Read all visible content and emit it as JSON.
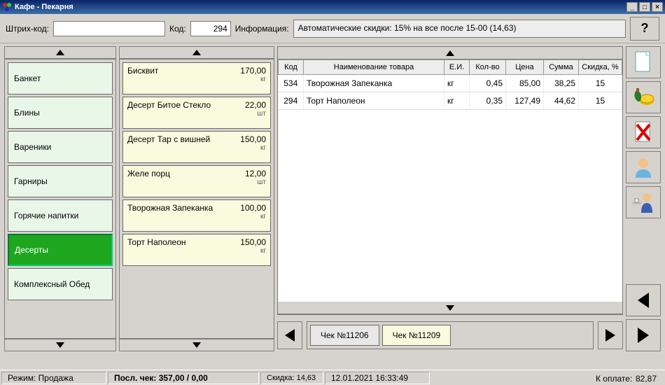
{
  "window": {
    "title": "Кафе - Пекарня"
  },
  "toprow": {
    "barcode_label": "Штрих-код:",
    "barcode_value": "",
    "code_label": "Код:",
    "code_value": "294",
    "info_label": "Информация:",
    "info_text": "Автоматические скидки: 15% на все после 15-00 (14,63)",
    "help_label": "?"
  },
  "categories": [
    {
      "label": "Банкет",
      "active": false
    },
    {
      "label": "Блины",
      "active": false
    },
    {
      "label": "Вареники",
      "active": false
    },
    {
      "label": "Гарниры",
      "active": false
    },
    {
      "label": "Горячие напитки",
      "active": false
    },
    {
      "label": "Десерты",
      "active": true
    },
    {
      "label": "Комплексный Обед",
      "active": false
    }
  ],
  "products": [
    {
      "name": "Бисквит",
      "price": "170,00",
      "unit": "кг"
    },
    {
      "name": "Десерт Битое Стекло",
      "price": "22,00",
      "unit": "шт"
    },
    {
      "name": "Десерт Тар с вишней",
      "price": "150,00",
      "unit": "кг"
    },
    {
      "name": "Желе порц",
      "price": "12,00",
      "unit": "шт"
    },
    {
      "name": "Творожная Запеканка",
      "price": "100,00",
      "unit": "кг"
    },
    {
      "name": "Торт Наполеон",
      "price": "150,00",
      "unit": "кг"
    }
  ],
  "grid": {
    "headers": {
      "code": "Код",
      "name": "Наименование товара",
      "unit": "Е.И.",
      "qty": "Кол-во",
      "price": "Цена",
      "sum": "Сумма",
      "disc": "Скидка, %"
    },
    "rows": [
      {
        "code": "534",
        "name": "Творожная Запеканка",
        "unit": "кг",
        "qty": "0,45",
        "price": "85,00",
        "sum": "38,25",
        "disc": "15"
      },
      {
        "code": "294",
        "name": "Торт Наполеон",
        "unit": "кг",
        "qty": "0,35",
        "price": "127,49",
        "sum": "44,62",
        "disc": "15"
      }
    ]
  },
  "tabs": [
    {
      "label": "Чек №11206",
      "active": false
    },
    {
      "label": "Чек №11209",
      "active": true
    }
  ],
  "sidebuttons": [
    {
      "name": "new-receipt-button",
      "icon": "doc"
    },
    {
      "name": "payment-button",
      "icon": "money"
    },
    {
      "name": "delete-button",
      "icon": "delete"
    },
    {
      "name": "customer-button",
      "icon": "person"
    },
    {
      "name": "waiter-button",
      "icon": "waiter"
    },
    {
      "name": "back-button",
      "icon": "triangle-left"
    },
    {
      "name": "forward-button",
      "icon": "triangle-right"
    }
  ],
  "status": {
    "mode_label": "Режим: Продажа",
    "last_check": "Посл. чек: 357,00 / 0,00",
    "discount": "Скидка: 14,63",
    "datetime": "12.01.2021 16:33:49",
    "total_label": "К оплате:",
    "total_value": "82,87"
  }
}
